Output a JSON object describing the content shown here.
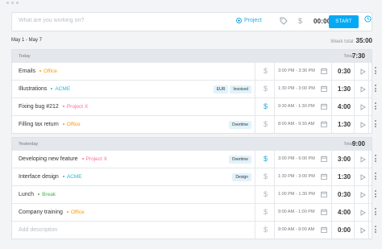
{
  "timer": {
    "placeholder": "What are you working on?",
    "project_label": "Project",
    "time": "00:00:00",
    "start_label": "START"
  },
  "week": {
    "range": "May 1 - May 7",
    "total_label": "Week total",
    "total": "35:00"
  },
  "colors": {
    "accent": "#03a9f4",
    "orange": "#ff9800",
    "pink": "#ff6b9a",
    "cyan": "#29b6d6",
    "green": "#4caf50"
  },
  "days": [
    {
      "label": "Today",
      "total_label": "Total",
      "total": "7:30",
      "entries": [
        {
          "description": "Emails",
          "project": "Office",
          "project_color": "#ff9800",
          "tags": [],
          "billable": false,
          "range": "3:00 PM - 3:30 PM",
          "duration": "0:30"
        },
        {
          "description": "Illustrations",
          "project": "ACME",
          "project_color": "#29b6d6",
          "tags": [
            "EUR",
            "Invoiced"
          ],
          "billable": false,
          "range": "1:30 PM - 3:00 PM",
          "duration": "1:30"
        },
        {
          "description": "Fixing bug #212",
          "project": "Project X",
          "project_color": "#ff6b9a",
          "tags": [],
          "billable": true,
          "range": "9:30 AM - 1:30 PM",
          "duration": "4:00"
        },
        {
          "description": "Filling tax return",
          "project": "Office",
          "project_color": "#ff9800",
          "tags": [
            "Overtime"
          ],
          "billable": false,
          "range": "8:00 AM - 9:30 AM",
          "duration": "1:30"
        }
      ]
    },
    {
      "label": "Yesterday",
      "total_label": "Total",
      "total": "9:00",
      "entries": [
        {
          "description": "Developing new feature",
          "project": "Project X",
          "project_color": "#ff6b9a",
          "tags": [
            "Overtime"
          ],
          "billable": true,
          "range": "3:00 PM - 6:00 PM",
          "duration": "3:00"
        },
        {
          "description": "Interface design",
          "project": "ACME",
          "project_color": "#29b6d6",
          "tags": [
            "Design"
          ],
          "billable": false,
          "range": "1:30 PM - 3:00 PM",
          "duration": "1:30"
        },
        {
          "description": "Lunch",
          "project": "Break",
          "project_color": "#4caf50",
          "tags": [],
          "billable": false,
          "range": "1:00 PM - 1:30 PM",
          "duration": "0:30"
        },
        {
          "description": "Company training",
          "project": "Office",
          "project_color": "#ff9800",
          "tags": [],
          "billable": false,
          "range": "9:00 AM - 1:00 PM",
          "duration": "4:00"
        },
        {
          "description": "Add description",
          "project": "",
          "project_color": "",
          "tags": [],
          "billable": false,
          "range": "9:00 AM - 9:00 AM",
          "duration": "0:00",
          "placeholder": true
        }
      ]
    }
  ]
}
